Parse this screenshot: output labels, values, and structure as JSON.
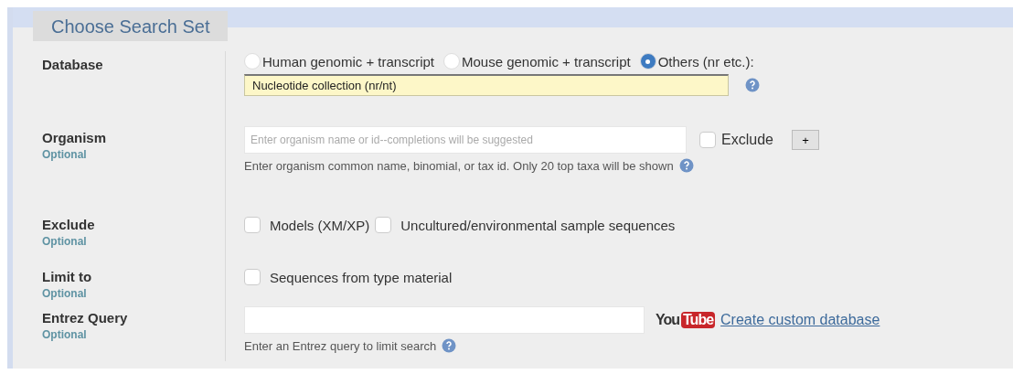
{
  "legend": "Choose Search Set",
  "rows": [
    {
      "label": "Database",
      "kind": "database",
      "radios": [
        {
          "label": "Human genomic + transcript",
          "selected": false
        },
        {
          "label": "Mouse genomic + transcript",
          "selected": false
        },
        {
          "label": "Others (nr etc.):",
          "selected": true
        }
      ],
      "select": {
        "value": "Nucleotide collection (nr/nt)"
      }
    },
    {
      "label": "Organism",
      "optional": "Optional",
      "kind": "organism",
      "input": {
        "placeholder": "Enter organism name or id--completions will be suggested"
      },
      "exclude": {
        "label": "Exclude",
        "checked": false
      },
      "add": "+",
      "hint": "Enter organism common name, binomial, or tax id. Only 20 top taxa will be shown"
    },
    {
      "label": "Exclude",
      "optional": "Optional",
      "kind": "checks",
      "checks": [
        {
          "label": "Models (XM/XP)",
          "checked": false
        },
        {
          "label": "Uncultured/environmental sample sequences",
          "checked": false
        }
      ]
    },
    {
      "label": "Limit to",
      "optional": "Optional",
      "kind": "checks",
      "checks": [
        {
          "label": "Sequences from type material",
          "checked": false
        }
      ]
    },
    {
      "label": "Entrez Query",
      "optional": "Optional",
      "kind": "entrez",
      "logo": [
        "You",
        "Tube"
      ],
      "link": "Create custom database",
      "hint": "Enter an Entrez query to limit search"
    }
  ]
}
